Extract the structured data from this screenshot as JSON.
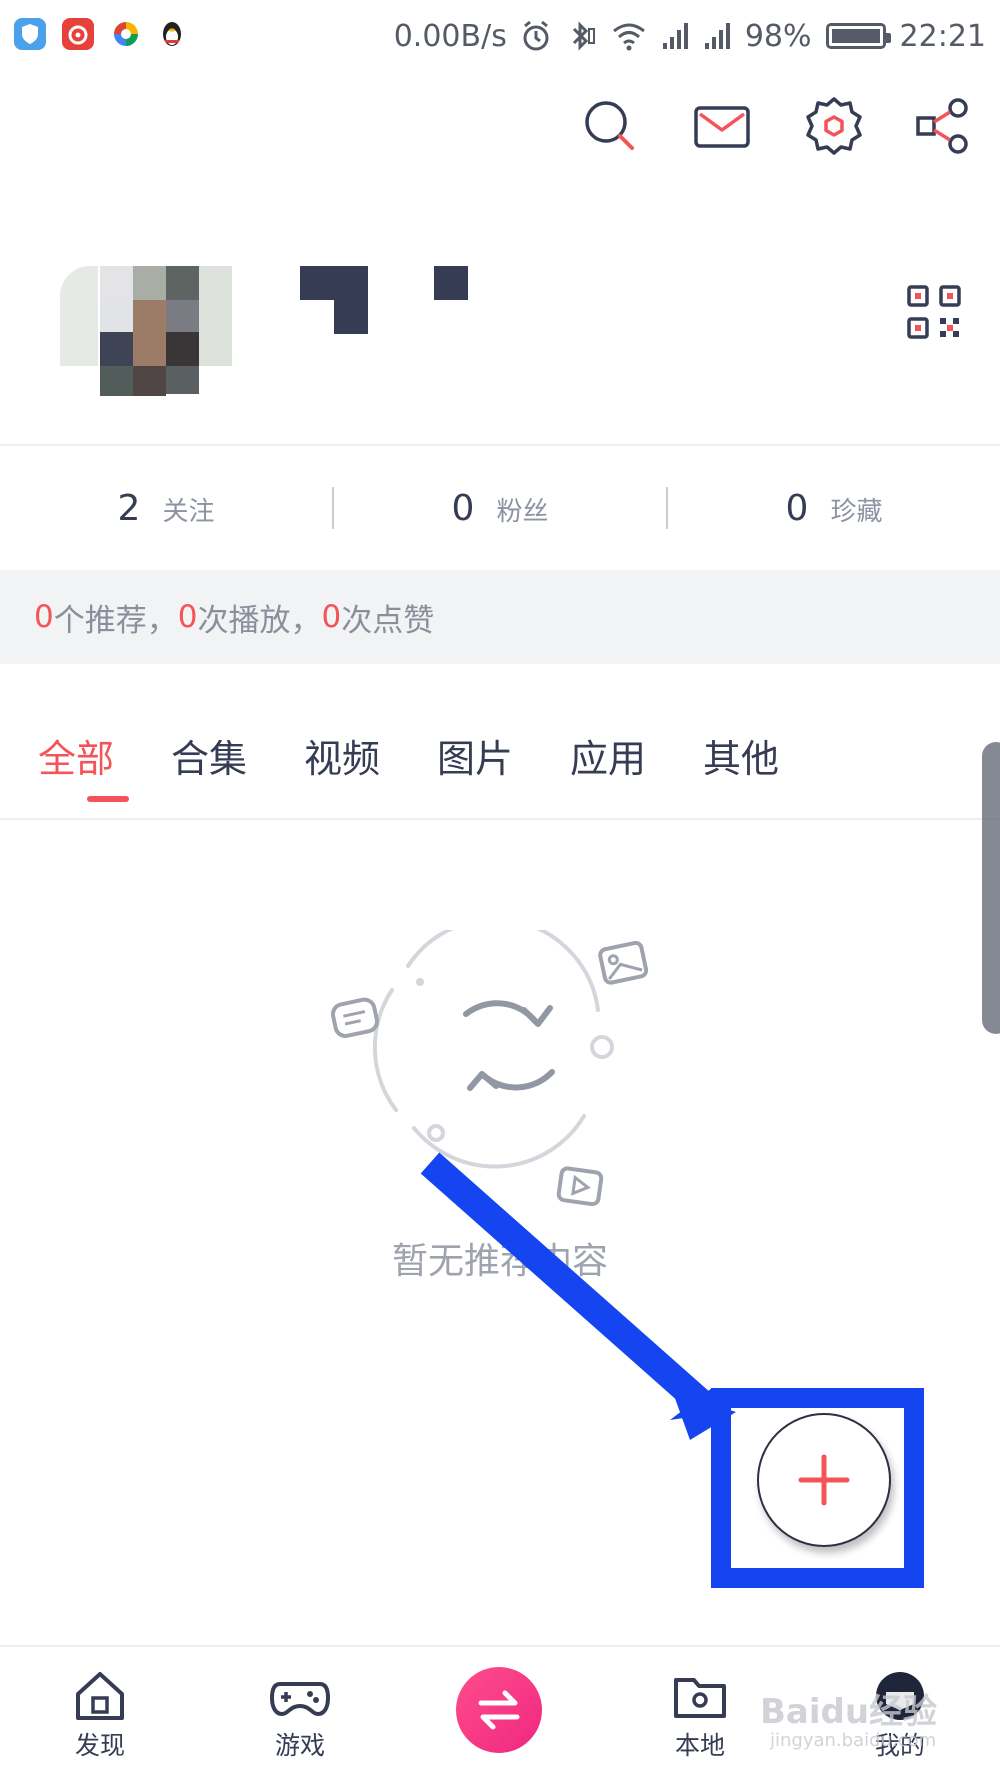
{
  "status_bar": {
    "net_speed": "0.00B/s",
    "battery": "98%",
    "time": "22:21",
    "app_icons": [
      "shield-app-icon",
      "netease-music-icon",
      "colorful-app-icon",
      "qq-penguin-icon"
    ]
  },
  "top_actions": [
    "search-icon",
    "mail-icon",
    "settings-icon",
    "share-icon"
  ],
  "stats": [
    {
      "value": "2",
      "label": "关注"
    },
    {
      "value": "0",
      "label": "粉丝"
    },
    {
      "value": "0",
      "label": "珍藏"
    }
  ],
  "summary": {
    "rec_count": "0",
    "rec_label": "个推荐，",
    "play_count": "0",
    "play_label": "次播放，",
    "like_count": "0",
    "like_label": "次点赞"
  },
  "tabs": [
    "全部",
    "合集",
    "视频",
    "图片",
    "应用",
    "其他"
  ],
  "active_tab": "全部",
  "empty_state": {
    "text": "暂无推荐内容"
  },
  "bottom_nav": {
    "discover": "发现",
    "games": "游戏",
    "local": "本地",
    "mine": "我的"
  },
  "watermark": {
    "main": "Baidu经验",
    "sub": "jingyan.baidu.com"
  },
  "colors": {
    "accent": "#f25459",
    "annotation": "#1445f0",
    "center_button": "#f0277f"
  }
}
